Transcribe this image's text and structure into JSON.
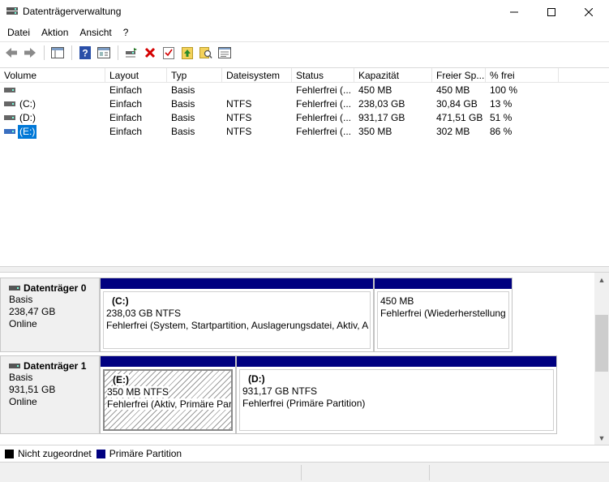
{
  "window": {
    "title": "Datenträgerverwaltung",
    "minimize_label": "—",
    "maximize_label": "□",
    "close_label": "✕"
  },
  "menu": [
    "Datei",
    "Aktion",
    "Ansicht",
    "?"
  ],
  "toolbar": {
    "buttons": [
      "back-icon",
      "forward-icon",
      "view-icon",
      "help-icon",
      "properties-icon",
      "connect-icon",
      "delete-icon",
      "check-icon",
      "up-icon",
      "search-icon",
      "settings-icon"
    ]
  },
  "volume_list": {
    "columns": [
      "Volume",
      "Layout",
      "Typ",
      "Dateisystem",
      "Status",
      "Kapazität",
      "Freier Sp...",
      "% frei"
    ],
    "rows": [
      {
        "volume": "",
        "layout": "Einfach",
        "typ": "Basis",
        "fs": "",
        "status": "Fehlerfrei (...",
        "capacity": "450 MB",
        "free": "450 MB",
        "pct": "100 %"
      },
      {
        "volume": "(C:)",
        "layout": "Einfach",
        "typ": "Basis",
        "fs": "NTFS",
        "status": "Fehlerfrei (...",
        "capacity": "238,03 GB",
        "free": "30,84 GB",
        "pct": "13 %"
      },
      {
        "volume": "(D:)",
        "layout": "Einfach",
        "typ": "Basis",
        "fs": "NTFS",
        "status": "Fehlerfrei (...",
        "capacity": "931,17 GB",
        "free": "471,51 GB",
        "pct": "51 %"
      },
      {
        "volume": "(E:)",
        "layout": "Einfach",
        "typ": "Basis",
        "fs": "NTFS",
        "status": "Fehlerfrei (...",
        "capacity": "350 MB",
        "free": "302 MB",
        "pct": "86 %"
      }
    ]
  },
  "disks": [
    {
      "name": "Datenträger 0",
      "type": "Basis",
      "size": "238,47 GB",
      "state": "Online",
      "partitions": [
        {
          "name": "(C:)",
          "size": "238,03 GB NTFS",
          "status": "Fehlerfrei (System, Startpartition, Auslagerungsdatei, Aktiv, A"
        },
        {
          "name": "",
          "size": "450 MB",
          "status": "Fehlerfrei (Wiederherstellung"
        }
      ]
    },
    {
      "name": "Datenträger 1",
      "type": "Basis",
      "size": "931,51 GB",
      "state": "Online",
      "partitions": [
        {
          "name": "(E:)",
          "size": "350 MB NTFS",
          "status": "Fehlerfrei (Aktiv, Primäre Par"
        },
        {
          "name": "(D:)",
          "size": "931,17 GB NTFS",
          "status": "Fehlerfrei (Primäre Partition)"
        }
      ]
    }
  ],
  "legend": [
    {
      "label": "Nicht zugeordnet",
      "color": "#000000"
    },
    {
      "label": "Primäre Partition",
      "color": "#000080"
    }
  ],
  "colors": {
    "primary_partition": "#000080",
    "selection": "#0078d7"
  }
}
